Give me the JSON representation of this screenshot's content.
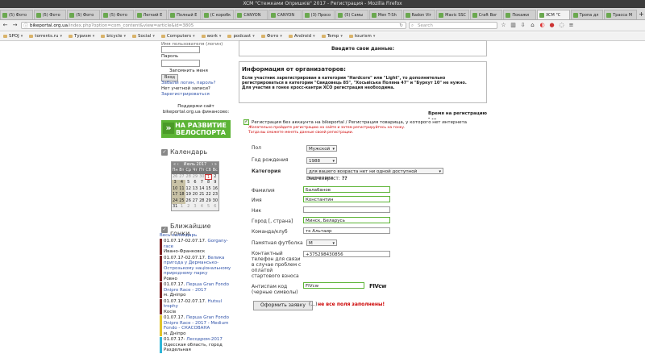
{
  "window": {
    "title": "XCM \"Стежками Опришків\" 2017 - Регистрация - Mozilla Firefox"
  },
  "tabs": [
    {
      "label": "(5) Фото"
    },
    {
      "label": "(5) Фото"
    },
    {
      "label": "(5) Фото"
    },
    {
      "label": "(5) Фото"
    },
    {
      "label": "Легкий Е"
    },
    {
      "label": "Полный Е"
    },
    {
      "label": "(С коробк"
    },
    {
      "label": "CANYON"
    },
    {
      "label": "CANYON"
    },
    {
      "label": "(3) Просо"
    },
    {
      "label": "(5) Самы"
    },
    {
      "label": "Men T-Sh"
    },
    {
      "label": "Radon Vir"
    },
    {
      "label": "Mavic SSC"
    },
    {
      "label": "Craft Bor"
    },
    {
      "label": "Покажи"
    },
    {
      "label": "XCM \"С"
    },
    {
      "label": "Тропа дл"
    },
    {
      "label": "Трасса М"
    }
  ],
  "nav": {
    "url_host": "bikeportal.org.ua",
    "url_rest": "/index.php?option=com_content&view=article&id=3805",
    "search_placeholder": "Search",
    "back": "←",
    "forward": "→",
    "reload": "↻",
    "home": "⌂",
    "menu": "≡"
  },
  "bookmarks": [
    {
      "label": "SPOJ"
    },
    {
      "label": "torrents.ru"
    },
    {
      "label": "Туризм"
    },
    {
      "label": "bicycle"
    },
    {
      "label": "Social"
    },
    {
      "label": "Computers"
    },
    {
      "label": "work"
    },
    {
      "label": "podcast"
    },
    {
      "label": "Фото"
    },
    {
      "label": "Android"
    },
    {
      "label": "Temp"
    },
    {
      "label": "tourism"
    }
  ],
  "sidebar": {
    "login_top": "Имя пользователя (логин)",
    "password_label": "Пароль",
    "remember_label": "Запомнить меня",
    "login_button": "Вход",
    "forgot_login": "Забыли логин, пароль?",
    "no_account": "Нет учетной записи?",
    "register": "Зарегистрироваться",
    "support_text": "Поддержи сайт bikeportal.org.ua финансово:",
    "banner_line1": "НА РАЗВИТИЕ",
    "banner_line2": "ВЕЛОСПОРТА",
    "calendar_title": "Календарь",
    "calendar_month": "Июль 2017",
    "calendar_prev": "« ‹",
    "calendar_next": "› »",
    "weekdays": [
      "Пн",
      "Вт",
      "Ср",
      "Чт",
      "Пт",
      "Сб",
      "Вс"
    ],
    "days": [
      "26",
      "27",
      "28",
      "29",
      "30",
      "1",
      "2",
      "3",
      "4",
      "5",
      "6",
      "7",
      "8",
      "9",
      "10",
      "11",
      "12",
      "13",
      "14",
      "15",
      "16",
      "17",
      "18",
      "19",
      "20",
      "21",
      "22",
      "23",
      "24",
      "25",
      "26",
      "27",
      "28",
      "29",
      "30",
      "31",
      "1",
      "2",
      "3",
      "4",
      "5",
      "6"
    ],
    "races_title": "Ближайшие гонки",
    "all_calendar": "Весь календарь",
    "races": [
      {
        "date": "01.07.17-02.07.17.",
        "name": "Gorgany-race",
        "place": "Ивано-Франковск",
        "color": "dark"
      },
      {
        "date": "01.07.17-02.07.17.",
        "name": "Велика пригода у Дермансько-Острозькому національному природному парку",
        "place": "Ровно",
        "color": "dark"
      },
      {
        "date": "01.07.17.",
        "name": "Першa Gran Fondo Dnipro Race - 2017",
        "place": "м. Днiпро",
        "color": "dark"
      },
      {
        "date": "01.07.17-02.07.17.",
        "name": "Hutsul trophy",
        "place": "Косiв",
        "color": "dark"
      },
      {
        "date": "01.07.17.",
        "name": "Першa Gran Fondo Dnipro Race - 2017 - Medium Fondo - СКАСОВАНА",
        "place": "м. Днiпро",
        "color": "y"
      },
      {
        "date": "01.07.17-",
        "name": "Лесодром-2017",
        "place": "Одесская область, город Раздельная",
        "color": "c"
      }
    ]
  },
  "main": {
    "enter_data": "Введите свои данные:",
    "org_title": "Информация от организаторов:",
    "org_text_1": "Если участник зарегистрирован в категории \"Hardcore\" или \"Light\", то дополнительно регистрироваться в категории \"Свидовець 85\", \"Хосьвiська Полянa 47\" и \"Буркут 10\" не нужно.",
    "org_text_2": "Для участия в гонке кросс-кантри XCO регистрация необходима.",
    "reg_time": "Время на регистрацию - ...",
    "no_account_check": "Регистрация без аккаунта на bikeportal / Регистрация товарища, у которого нет интернета",
    "warn_1": "Желательно пройдите регистрацию на сайте и затем регистрируйтесь на гонку.",
    "warn_2": "Тогда вы сможете менять данные своей регистрации.",
    "sex_label": "Пол",
    "sex_value": "Мужской",
    "birth_label": "Год рождения",
    "birth_value": "1988",
    "category_label": "Категория",
    "category_value": "для вашего возраста нет ни одной доступной категории",
    "age_label": "Ваш возраст:",
    "age_value": "??",
    "surname_label": "Фамилия",
    "surname_value": "Балабанов",
    "name_label": "Имя",
    "name_value": "Константин",
    "nick_label": "Ник",
    "nick_value": "",
    "city_label": "Город [, страна]",
    "city_value": "Минск, Беларусь",
    "team_label": "Команда/клуб",
    "team_value": "тк Альтаир",
    "shirt_label": "Памятная футболка",
    "shirt_value": "M",
    "phone_label": "Контактный телефон для связи в случае проблем с оплатой стартового взноса",
    "phone_value": "+375298430856",
    "antispam_label": "Антиспам код (черные символы)",
    "antispam_value": "FIVcw",
    "captcha": "FIVcw",
    "submit_label": "Оформить заявку",
    "submit_dots": "(...)",
    "error": "не все поля заполнены!"
  }
}
